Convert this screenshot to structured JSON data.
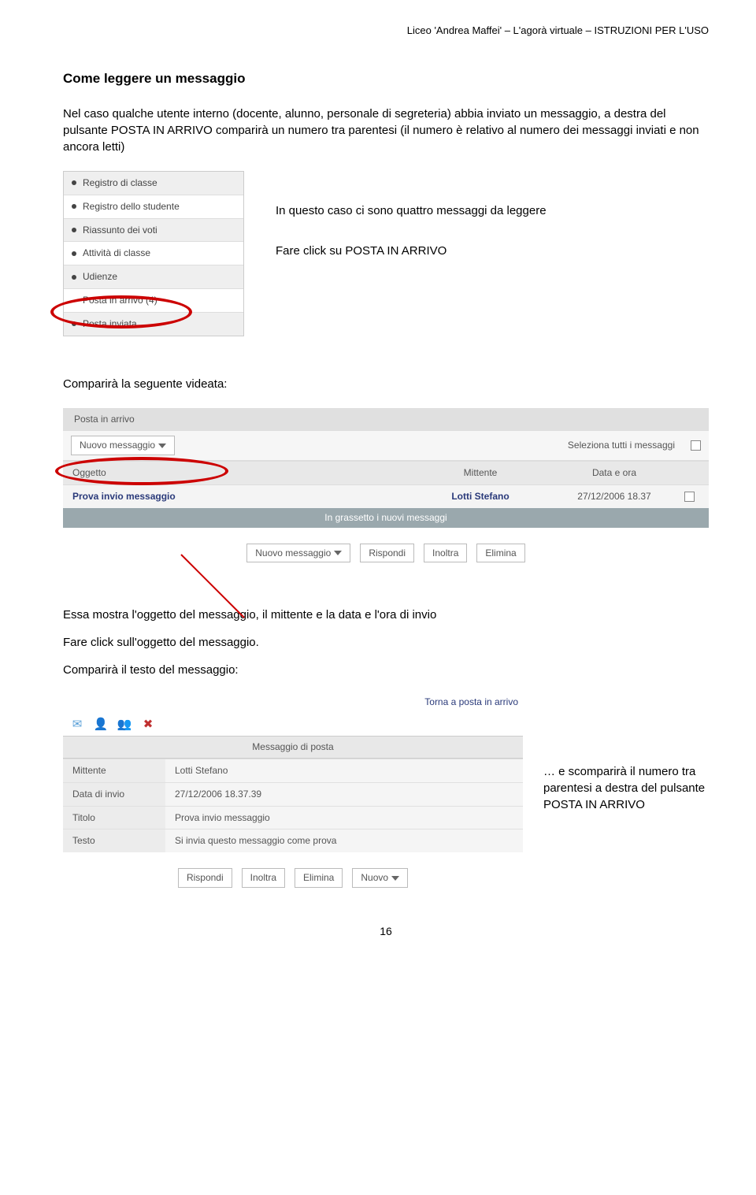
{
  "header": "Liceo 'Andrea Maffei' – L'agorà virtuale – ISTRUZIONI PER L'USO",
  "title": "Come leggere un messaggio",
  "intro_part1": "Nel caso qualche utente interno (docente, alunno, personale di segreteria) abbia inviato un messaggio, a destra del pulsante ",
  "intro_posta": "POSTA IN ARRIVO",
  "intro_part2": " comparirà un numero tra parentesi (il numero è relativo al numero dei messaggi inviati e non ancora letti)",
  "sidebar": {
    "items": [
      {
        "label": "Registro di classe",
        "grey": true
      },
      {
        "label": "Registro dello studente",
        "grey": false
      },
      {
        "label": "Riassunto dei voti",
        "grey": true
      },
      {
        "label": "Attività di classe",
        "grey": false
      },
      {
        "label": "Udienze",
        "grey": true
      },
      {
        "label": "Posta in arrivo (4)",
        "grey": false,
        "highlight": true
      },
      {
        "label": "Posta inviata",
        "grey": true
      }
    ]
  },
  "annot1": "In questo caso ci sono quattro messaggi da leggere",
  "annot2_a": "Fare click su ",
  "annot2_b": "POSTA IN ARRIVO",
  "caption_videata": "Comparirà la seguente videata:",
  "inbox": {
    "title": "Posta in arrivo",
    "new_msg": "Nuovo messaggio",
    "select_all": "Seleziona tutti i messaggi",
    "cols": {
      "subject": "Oggetto",
      "sender": "Mittente",
      "date": "Data e ora"
    },
    "row": {
      "subject": "Prova invio messaggio",
      "sender": "Lotti Stefano",
      "date": "27/12/2006 18.37"
    },
    "bold_note": "In grassetto i nuovi messaggi",
    "buttons": {
      "new": "Nuovo messaggio",
      "reply": "Rispondi",
      "fwd": "Inoltra",
      "del": "Elimina"
    }
  },
  "desc_below1": "Essa mostra l'oggetto del messaggio, il mittente e la data e l'ora di invio",
  "desc_below2": "Fare click sull'oggetto del messaggio.",
  "desc_below3": "Comparirà il testo del messaggio:",
  "detail": {
    "back": "Torna a posta in arrivo",
    "panel_title": "Messaggio di posta",
    "rows": {
      "Mittente": "Lotti Stefano",
      "Data di invio": "27/12/2006 18.37.39",
      "Titolo": "Prova invio messaggio",
      "Testo": "Si invia questo messaggio come prova"
    },
    "buttons": {
      "reply": "Rispondi",
      "fwd": "Inoltra",
      "del": "Elimina",
      "new": "Nuovo"
    }
  },
  "aside_a": "… e scomparirà il numero tra parentesi a destra del pulsante ",
  "aside_b": "POSTA IN ARRIVO",
  "pagenum": "16",
  "labels": {
    "mittente": "Mittente",
    "data": "Data di invio",
    "titolo": "Titolo",
    "testo": "Testo"
  }
}
